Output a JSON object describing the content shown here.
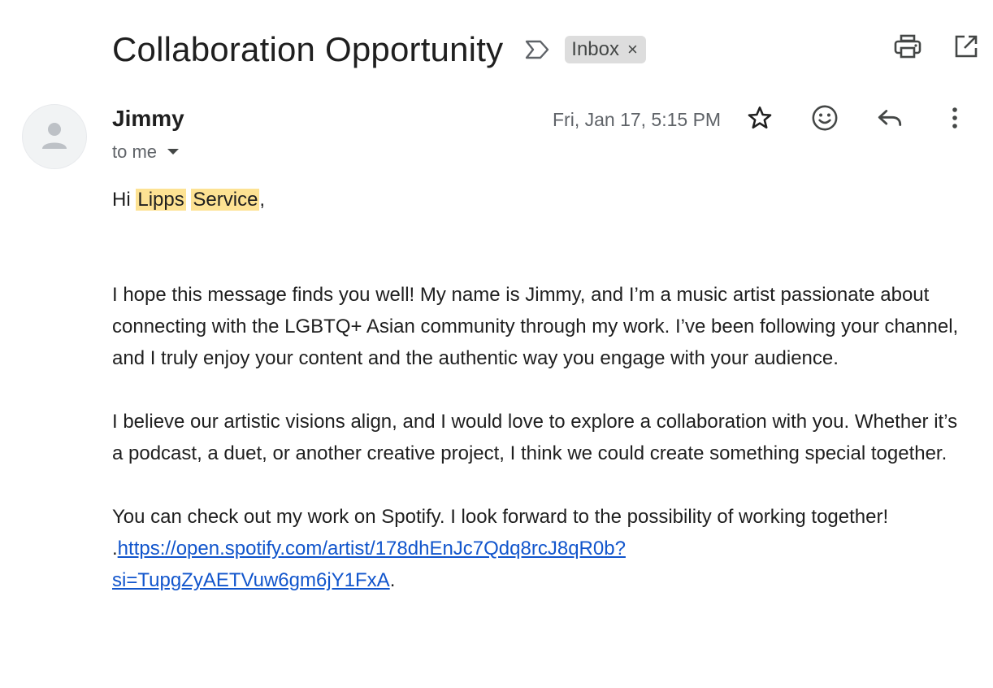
{
  "email": {
    "subject": "Collaboration Opportunity",
    "label": "Inbox",
    "label_remove": "×",
    "sender": "Jimmy",
    "recipient": "to me",
    "date": "Fri, Jan 17, 5:15 PM"
  },
  "body": {
    "greeting_prefix": "Hi ",
    "greeting_name_1": "Lipps",
    "greeting_name_2": "Service",
    "greeting_suffix": ",",
    "paragraph_1": "I hope this message finds you well! My name is Jimmy, and I’m a music artist passionate about connecting with the LGBTQ+ Asian community through my work. I’ve been following your channel, and I truly enjoy your content and the authentic way you engage with your audience.",
    "paragraph_2": "I believe our artistic visions align, and I would love to explore a collaboration with you. Whether it’s a podcast, a duet, or another creative project, I think we could create something special together.",
    "paragraph_3": "You can check out my work on Spotify. I look forward to the possibility of working together!",
    "link_prefix": ".",
    "link_line_1": "https://open.spotify.com/artist/178dhEnJc7Qdq8rcJ8qR0b?",
    "link_line_2": "si=TupgZyAETVuw6gm6jY1FxA",
    "link_suffix": "."
  },
  "icons": {
    "important": "label-important-icon",
    "print": "print-icon",
    "open_new_window": "open-in-new-icon",
    "star": "star-icon",
    "emoji": "emoji-icon",
    "reply": "reply-icon",
    "more": "more-vert-icon",
    "avatar": "avatar-person-icon",
    "dropdown": "caret-down-icon"
  },
  "colors": {
    "highlight": "#fde293",
    "link": "#1155cc",
    "label_bg": "#dddddd"
  }
}
